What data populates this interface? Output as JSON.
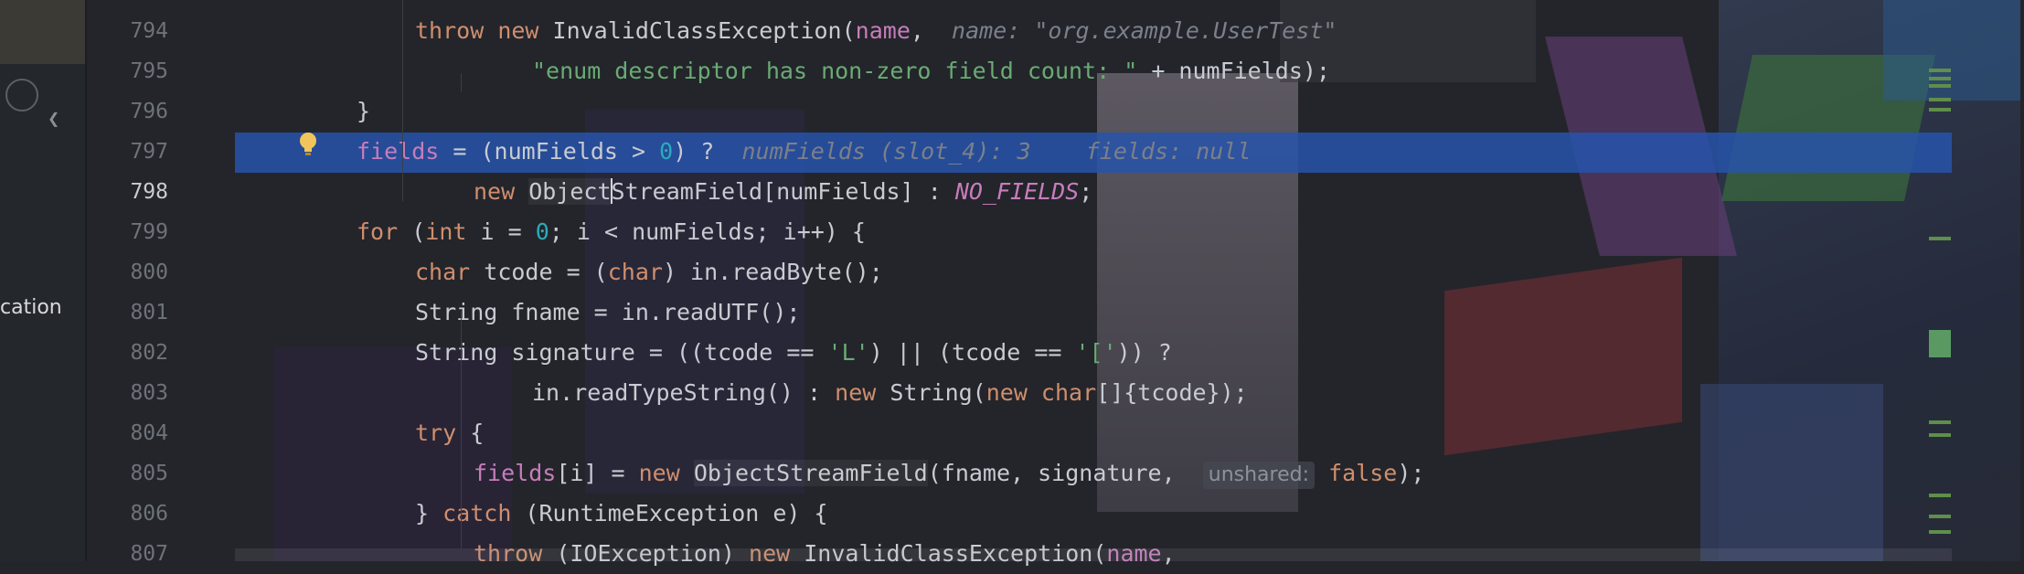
{
  "sidebar": {
    "project_label": "cation",
    "collapse_glyph": "❮"
  },
  "editor": {
    "lines": [
      {
        "no": "794",
        "parts": [
          [
            "kw",
            "throw "
          ],
          [
            "kw",
            "new "
          ],
          [
            "",
            "InvalidClassException("
          ],
          [
            "fld",
            "name"
          ],
          [
            "",
            ",  "
          ],
          [
            "hint",
            "name: \"org.example.UserTest\""
          ]
        ],
        "indent": 1
      },
      {
        "no": "795",
        "parts": [
          [
            "str",
            "\"enum descriptor has non-zero field count: \""
          ],
          [
            "",
            " + numFields);"
          ]
        ],
        "indent": 3
      },
      {
        "no": "796",
        "parts": [
          [
            "",
            "}"
          ]
        ],
        "indent": 0
      },
      {
        "no": "797",
        "parts": [
          [
            "fld",
            "fields"
          ],
          [
            "",
            " = (numFields > "
          ],
          [
            "num",
            "0"
          ],
          [
            "",
            ") ?  "
          ],
          [
            "hint",
            "numFields (slot_4): 3    fields: null"
          ]
        ],
        "indent": 0
      },
      {
        "no": "798",
        "parts": [
          [
            "kw",
            "new "
          ],
          [
            "cls",
            "Object"
          ],
          [
            "caret",
            ""
          ],
          [
            "",
            "StreamField[numFields] : "
          ],
          [
            "const",
            "NO_FIELDS"
          ],
          [
            "",
            ";"
          ]
        ],
        "indent": 2
      },
      {
        "no": "799",
        "parts": [
          [
            "kw",
            "for "
          ],
          [
            "",
            "("
          ],
          [
            "kw",
            "int "
          ],
          [
            "",
            "i = "
          ],
          [
            "num",
            "0"
          ],
          [
            "",
            "; i < numFields; i++) {"
          ]
        ],
        "indent": 0
      },
      {
        "no": "800",
        "parts": [
          [
            "kw",
            "char "
          ],
          [
            "",
            "tcode = ("
          ],
          [
            "kw",
            "char"
          ],
          [
            "",
            ") in.readByte();"
          ]
        ],
        "indent": 1
      },
      {
        "no": "801",
        "parts": [
          [
            "",
            "String fname = in.readUTF();"
          ]
        ],
        "indent": 1
      },
      {
        "no": "802",
        "parts": [
          [
            "",
            "String signature = ((tcode == "
          ],
          [
            "str",
            "'L'"
          ],
          [
            "",
            ") || (tcode == "
          ],
          [
            "str",
            "'['"
          ],
          [
            "",
            ")) ?"
          ]
        ],
        "indent": 1
      },
      {
        "no": "803",
        "parts": [
          [
            "",
            "in.readTypeString() : "
          ],
          [
            "kw",
            "new "
          ],
          [
            "",
            "String("
          ],
          [
            "kw",
            "new char"
          ],
          [
            "",
            "[]{tcode});"
          ]
        ],
        "indent": 3
      },
      {
        "no": "804",
        "parts": [
          [
            "kw",
            "try "
          ],
          [
            "",
            "{"
          ]
        ],
        "indent": 1
      },
      {
        "no": "805",
        "parts": [
          [
            "fld",
            "fields"
          ],
          [
            "",
            "[i] = "
          ],
          [
            "kw",
            "new "
          ],
          [
            "cls",
            "ObjectStreamField"
          ],
          [
            "",
            "(fname, signature,  "
          ],
          [
            "inlay",
            "unshared:"
          ],
          [
            "",
            " "
          ],
          [
            "kw",
            "false"
          ],
          [
            "",
            ");"
          ]
        ],
        "indent": 2
      },
      {
        "no": "806",
        "parts": [
          [
            "",
            "} "
          ],
          [
            "kw",
            "catch "
          ],
          [
            "",
            "(RuntimeException e) {"
          ]
        ],
        "indent": 1
      },
      {
        "no": "807",
        "parts": [
          [
            "kw",
            "throw "
          ],
          [
            "",
            "(IOException) "
          ],
          [
            "kw",
            "new "
          ],
          [
            "",
            "InvalidClassException("
          ],
          [
            "fld",
            "name"
          ],
          [
            "",
            ","
          ]
        ],
        "indent": 2
      }
    ],
    "current_line": "798",
    "highlight_line": "797"
  },
  "colors": {
    "selection": "#2753aa",
    "keyword": "#cf8e6d",
    "string": "#6aab73",
    "number": "#2aacb8",
    "field": "#c77dbb"
  },
  "icons": [
    "intention-bulb-icon"
  ]
}
